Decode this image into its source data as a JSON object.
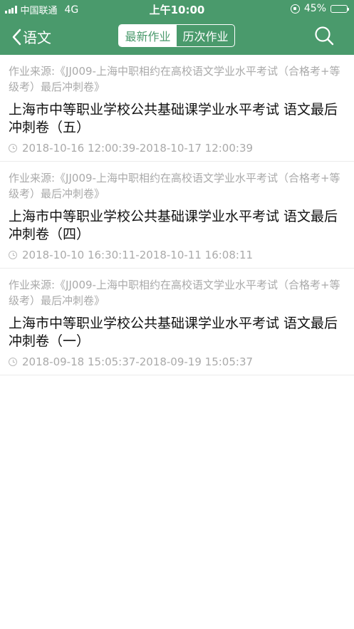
{
  "status_bar": {
    "carrier": "中国联通",
    "network": "4G",
    "time": "上午10:00",
    "battery": "45%",
    "battery_level": 0.45,
    "battery_color": "#f5c518"
  },
  "nav": {
    "back_label": "语文",
    "back_icon": "chevron-left-icon",
    "tabs": [
      {
        "label": "最新作业",
        "active": true
      },
      {
        "label": "历次作业",
        "active": false
      }
    ],
    "search_icon": "search-icon"
  },
  "colors": {
    "primary": "#4a9a6c",
    "muted": "#aaaaaa"
  },
  "items": [
    {
      "source": "作业来源:《JJ009-上海中职相约在高校语文学业水平考试（合格考+等级考）最后冲刺卷》",
      "title": "上海市中等职业学校公共基础课学业水平考试 语文最后冲刺卷（五）",
      "time": "2018-10-16 12:00:39-2018-10-17 12:00:39"
    },
    {
      "source": "作业来源:《JJ009-上海中职相约在高校语文学业水平考试（合格考+等级考）最后冲刺卷》",
      "title": "上海市中等职业学校公共基础课学业水平考试 语文最后冲刺卷（四）",
      "time": "2018-10-10 16:30:11-2018-10-11 16:08:11"
    },
    {
      "source": "作业来源:《JJ009-上海中职相约在高校语文学业水平考试（合格考+等级考）最后冲刺卷》",
      "title": "上海市中等职业学校公共基础课学业水平考试 语文最后冲刺卷（一）",
      "time": "2018-09-18 15:05:37-2018-09-19 15:05:37"
    }
  ]
}
